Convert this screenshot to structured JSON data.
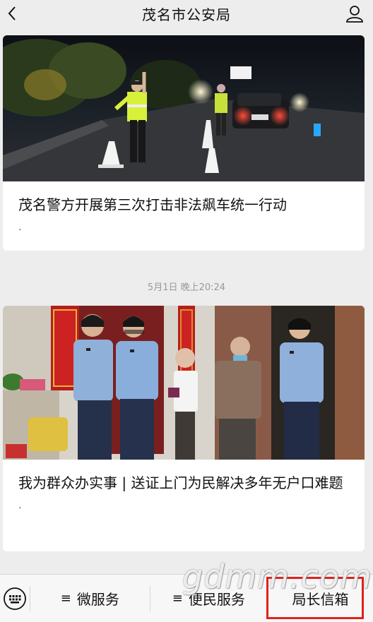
{
  "header": {
    "title": "茂名市公安局",
    "back_icon": "back-chevron-icon",
    "profile_icon": "person-icon"
  },
  "articles": [
    {
      "headline": "茂名警方开展第三次打击非法飙车统一行动",
      "dot": ".",
      "image": "night-traffic-checkpoint-photo"
    },
    {
      "headline": "我为群众办实事 | 送证上门为民解决多年无户口难题",
      "dot": ".",
      "image": "police-officers-delivering-certificate-photo"
    }
  ],
  "timestamp": "5月1日 晚上20:24",
  "bottom_menu": {
    "keyboard_icon": "keyboard-icon",
    "items": [
      {
        "prefix": "≡",
        "label": "微服务"
      },
      {
        "prefix": "≡",
        "label": "便民服务"
      },
      {
        "prefix": "",
        "label": "局长信箱"
      }
    ],
    "highlight_color": "#e0211c"
  },
  "watermark": "gdmm.com"
}
